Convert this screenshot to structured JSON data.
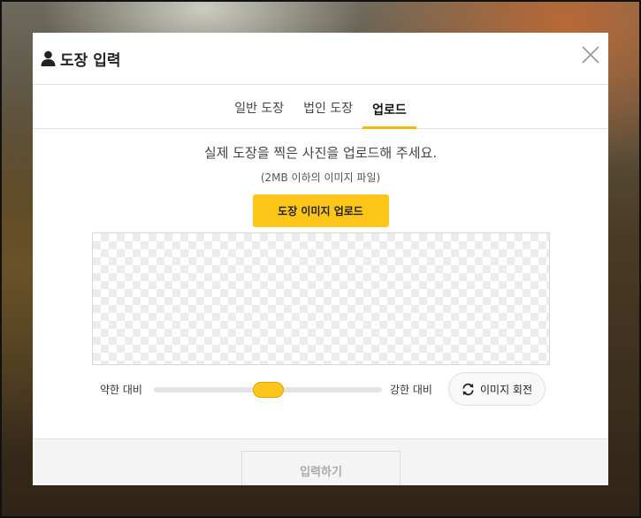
{
  "modal": {
    "title": "도장 입력",
    "title_icon": "user-icon",
    "close_icon": "close-icon"
  },
  "tabs": [
    {
      "label": "일반 도장",
      "active": false
    },
    {
      "label": "법인 도장",
      "active": false
    },
    {
      "label": "업로드",
      "active": true
    }
  ],
  "upload": {
    "description": "실제 도장을 찍은 사진을 업로드해 주세요.",
    "subtext": "(2MB 이하의 이미지 파일)",
    "button_label": "도장 이미지 업로드"
  },
  "contrast": {
    "weak_label": "약한 대비",
    "strong_label": "강한 대비",
    "level": 0.5
  },
  "rotate": {
    "label": "이미지 회전",
    "icon": "rotate-icon"
  },
  "footer": {
    "submit_label": "입력하기",
    "submit_enabled": false
  },
  "colors": {
    "accent": "#ffc61a",
    "active_tab_underline": "#f5b800"
  }
}
